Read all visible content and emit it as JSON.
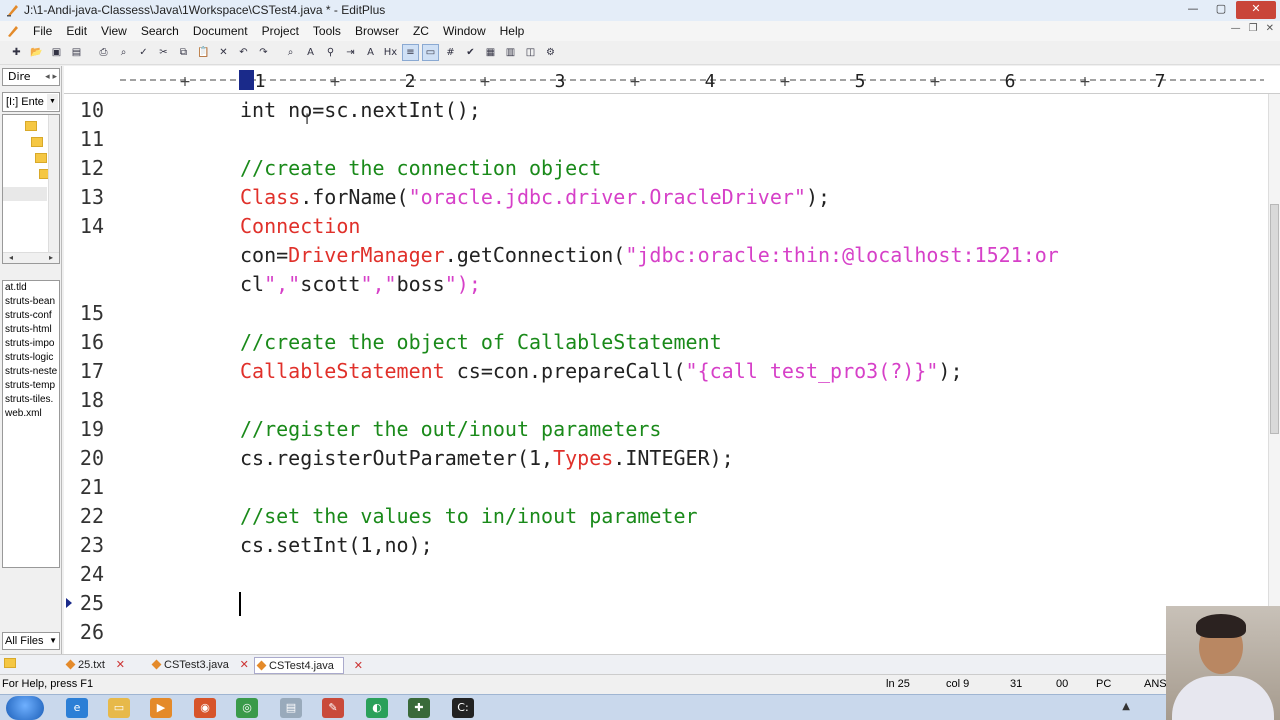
{
  "window": {
    "title": "J:\\1-Andi-java-Classess\\Java\\1Workspace\\CSTest4.java * - EditPlus",
    "buttons": [
      "—",
      "▢",
      "✕"
    ]
  },
  "menu": [
    "File",
    "Edit",
    "View",
    "Search",
    "Document",
    "Project",
    "Tools",
    "Browser",
    "ZC",
    "Window",
    "Help"
  ],
  "left_panel": {
    "dir_tab": "Dire",
    "drive": "[I:] Ente",
    "files": [
      "at.tld",
      "struts-bean",
      "struts-conf",
      "struts-html",
      "struts-impo",
      "struts-logic",
      "struts-neste",
      "struts-temp",
      "struts-tiles.",
      "web.xml"
    ],
    "filter": "All Files"
  },
  "ruler": {
    "marks": [
      "1",
      "2",
      "3",
      "4",
      "5",
      "6",
      "7"
    ]
  },
  "code_lines": [
    {
      "n": "10",
      "code": "int no=sc.nextInt();"
    },
    {
      "n": "11",
      "code": ""
    },
    {
      "n": "12",
      "code": "//create the connection object"
    },
    {
      "n": "13",
      "code": "Class.forName(\"oracle.jdbc.driver.OracleDriver\");"
    },
    {
      "n": "14",
      "code": "Connection"
    },
    {
      "n": "",
      "code": "con=DriverManager.getConnection(\"jdbc:oracle:thin:@localhost:1521:or"
    },
    {
      "n": "",
      "code": "cl\",\"scott\",\"boss\");"
    },
    {
      "n": "15",
      "code": ""
    },
    {
      "n": "16",
      "code": "//create the object of CallableStatement"
    },
    {
      "n": "17",
      "code": "CallableStatement cs=con.prepareCall(\"{call test_pro3(?)}\");"
    },
    {
      "n": "18",
      "code": ""
    },
    {
      "n": "19",
      "code": "//register the out/inout parameters"
    },
    {
      "n": "20",
      "code": "cs.registerOutParameter(1,Types.INTEGER);"
    },
    {
      "n": "21",
      "code": ""
    },
    {
      "n": "22",
      "code": "//set the values to in/inout parameter"
    },
    {
      "n": "23",
      "code": "cs.setInt(1,no);"
    },
    {
      "n": "24",
      "code": ""
    },
    {
      "n": "25",
      "code": ""
    },
    {
      "n": "26",
      "code": ""
    }
  ],
  "tabs": [
    {
      "label": "25.txt",
      "active": false
    },
    {
      "label": "CSTest3.java",
      "active": false
    },
    {
      "label": "CSTest4.java",
      "active": true
    }
  ],
  "status": {
    "help": "For Help, press F1",
    "line": "ln 25",
    "col": "col 9",
    "num": "31",
    "code": "00",
    "mode": "PC",
    "enc": "ANS"
  },
  "colors": {
    "comment": "#1a8a1a",
    "class": "#e0302a",
    "string": "#d640c8",
    "text": "#222222"
  }
}
